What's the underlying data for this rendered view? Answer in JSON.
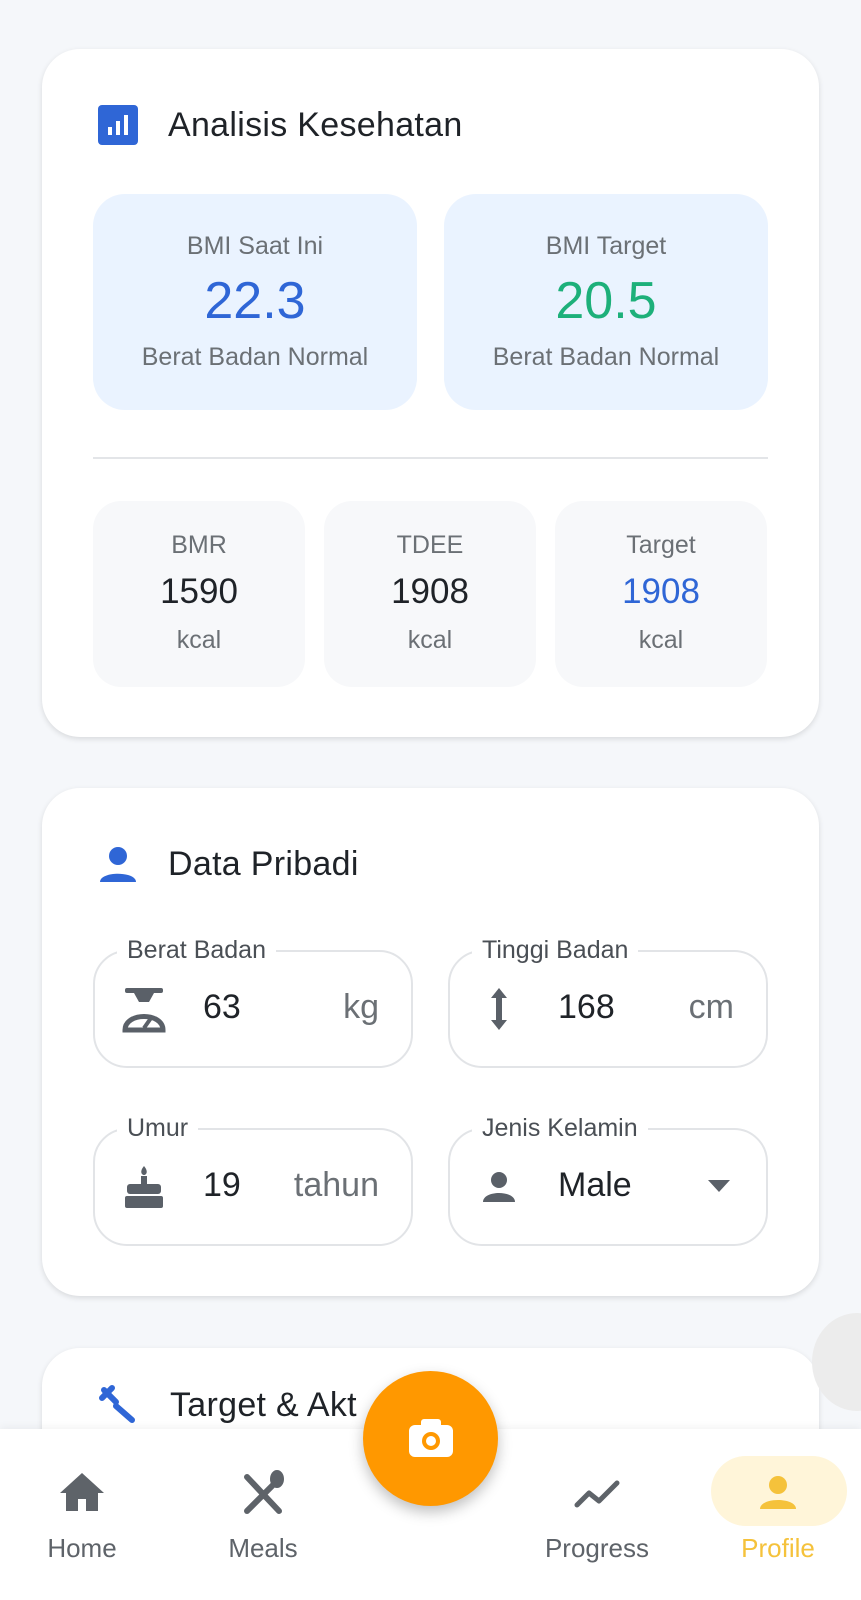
{
  "colors": {
    "accent_blue": "#2f66d6",
    "accent_green": "#1db07a",
    "accent_orange": "#ff9800",
    "accent_yellow": "#f5c23b"
  },
  "health": {
    "title": "Analisis Kesehatan",
    "icon": "bar-chart-icon",
    "bmi_current": {
      "label": "BMI Saat Ini",
      "value": "22.3",
      "status": "Berat Badan Normal"
    },
    "bmi_target": {
      "label": "BMI Target",
      "value": "20.5",
      "status": "Berat Badan Normal"
    },
    "stats": [
      {
        "label": "BMR",
        "value": "1590",
        "unit": "kcal"
      },
      {
        "label": "TDEE",
        "value": "1908",
        "unit": "kcal"
      },
      {
        "label": "Target",
        "value": "1908",
        "unit": "kcal"
      }
    ]
  },
  "personal": {
    "title": "Data Pribadi",
    "icon": "person-icon",
    "weight": {
      "label": "Berat Badan",
      "value": "63",
      "unit": "kg",
      "icon": "scale-icon"
    },
    "height": {
      "label": "Tinggi Badan",
      "value": "168",
      "unit": "cm",
      "icon": "height-icon"
    },
    "age": {
      "label": "Umur",
      "value": "19",
      "unit": "tahun",
      "icon": "cake-icon"
    },
    "gender": {
      "label": "Jenis Kelamin",
      "value": "Male",
      "icon": "person-icon"
    }
  },
  "target_section": {
    "title": "Target & Akt",
    "icon": "target-icon"
  },
  "nav": {
    "home": "Home",
    "meals": "Meals",
    "progress": "Progress",
    "profile": "Profile",
    "active": "profile"
  }
}
